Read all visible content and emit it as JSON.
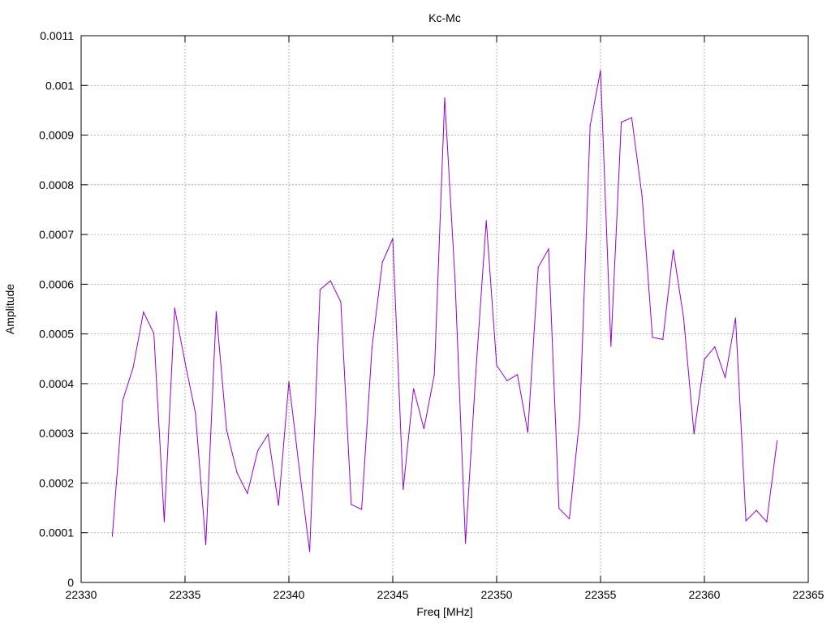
{
  "chart_data": {
    "type": "line",
    "title": "Kc-Mc",
    "xlabel": "Freq [MHz]",
    "ylabel": "Amplitude",
    "xlim": [
      22330,
      22365
    ],
    "ylim": [
      0,
      0.0011
    ],
    "x_ticks": [
      22330,
      22335,
      22340,
      22345,
      22350,
      22355,
      22360,
      22365
    ],
    "x_tick_labels": [
      "22330",
      "22335",
      "22340",
      "22345",
      "22350",
      "22355",
      "22360",
      "22365"
    ],
    "y_ticks": [
      0,
      0.0001,
      0.0002,
      0.0003,
      0.0004,
      0.0005,
      0.0006,
      0.0007,
      0.0008,
      0.0009,
      0.001,
      0.0011
    ],
    "y_tick_labels": [
      "0",
      "0.0001",
      "0.0002",
      "0.0003",
      "0.0004",
      "0.0005",
      "0.0006",
      "0.0007",
      "0.0008",
      "0.0009",
      "0.001",
      "0.0011"
    ],
    "grid": true,
    "series": [
      {
        "color": "#9400d3",
        "x": [
          22331.5,
          22332,
          22332.5,
          22333,
          22333.5,
          22334,
          22334.5,
          22335,
          22335.5,
          22336,
          22336.5,
          22337,
          22337.5,
          22338,
          22338.5,
          22339,
          22339.5,
          22340,
          22340.5,
          22341,
          22341.5,
          22342,
          22342.5,
          22343,
          22343.5,
          22344,
          22344.5,
          22345,
          22345.5,
          22346,
          22346.5,
          22347,
          22347.5,
          22348,
          22348.5,
          22349,
          22349.5,
          22350,
          22350.5,
          22351,
          22351.5,
          22352,
          22352.5,
          22353,
          22353.5,
          22354,
          22354.5,
          22355,
          22355.5,
          22356,
          22356.5,
          22357,
          22357.5,
          22358,
          22358.5,
          22359,
          22359.5,
          22360,
          22360.5,
          22361,
          22361.5,
          22362,
          22362.5,
          22363,
          22363.5
        ],
        "y": [
          9.3e-05,
          0.000366,
          0.000432,
          0.000544,
          0.000501,
          0.000122,
          0.000552,
          0.000443,
          0.000341,
          7.6e-05,
          0.000545,
          0.000307,
          0.000221,
          0.000179,
          0.000265,
          0.000298,
          0.000155,
          0.000404,
          0.000229,
          6.2e-05,
          0.000589,
          0.000607,
          0.000564,
          0.000157,
          0.000147,
          0.000473,
          0.000644,
          0.000692,
          0.000187,
          0.00039,
          0.000309,
          0.000418,
          0.000975,
          0.000606,
          7.9e-05,
          0.000424,
          0.000728,
          0.000437,
          0.000406,
          0.000418,
          0.000302,
          0.000634,
          0.000671,
          0.000149,
          0.000128,
          0.000331,
          0.000919,
          0.00103,
          0.000475,
          0.000926,
          0.000935,
          0.000777,
          0.000493,
          0.000489,
          0.000669,
          0.000532,
          0.000299,
          0.000449,
          0.000474,
          0.000412,
          0.000532,
          0.000124,
          0.000145,
          0.000122,
          0.000285
        ]
      }
    ]
  }
}
